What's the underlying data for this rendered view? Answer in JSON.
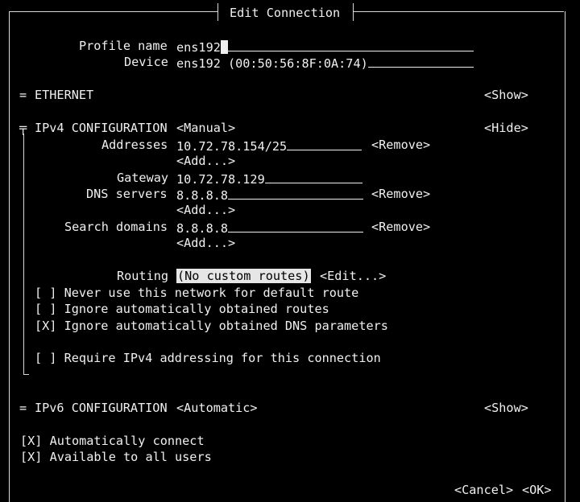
{
  "dialog": {
    "title": "Edit Connection"
  },
  "profile": {
    "label": "Profile name",
    "value": "ens192"
  },
  "device": {
    "label": "Device",
    "value": "ens192 (00:50:56:8F:0A:74)"
  },
  "ethernet": {
    "label": "ETHERNET",
    "toggle": "<Show>"
  },
  "ipv4": {
    "label": "IPv4 CONFIGURATION",
    "mode": "<Manual>",
    "toggle": "<Hide>",
    "addresses_label": "Addresses",
    "address": "10.72.78.154/25",
    "gateway_label": "Gateway",
    "gateway": "10.72.78.129",
    "dns_label": "DNS servers",
    "dns": "8.8.8.8",
    "search_label": "Search domains",
    "search": "8.8.8.8",
    "remove": "<Remove>",
    "add": "<Add...>",
    "routing_label": "Routing",
    "routing_value": "(No custom routes)",
    "routing_edit": "<Edit...>",
    "never_default": "[ ] Never use this network for default route",
    "ignore_routes": "[ ] Ignore automatically obtained routes",
    "ignore_dns": "[X] Ignore automatically obtained DNS parameters",
    "require_ipv4": "[ ] Require IPv4 addressing for this connection"
  },
  "ipv6": {
    "label": "IPv6 CONFIGURATION",
    "mode": "<Automatic>",
    "toggle": "<Show>"
  },
  "auto_connect": "[X] Automatically connect",
  "all_users": "[X] Available to all users",
  "buttons": {
    "cancel": "<Cancel>",
    "ok": "<OK>"
  }
}
